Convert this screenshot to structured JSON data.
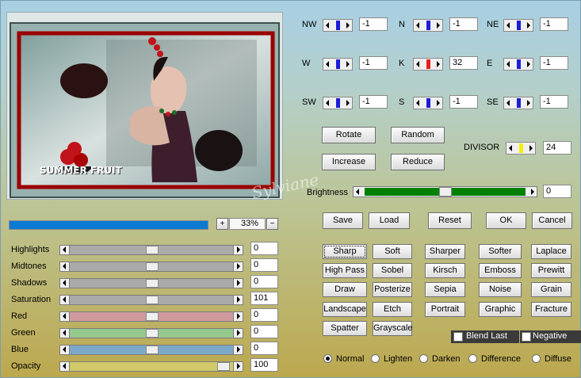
{
  "preview": {
    "text": "SUMMER FRUIT",
    "watermark": "Sylviane"
  },
  "zoom": {
    "plus": "+",
    "minus": "−",
    "value": "33%"
  },
  "direction": [
    {
      "key": "nw",
      "label": "NW",
      "value": "-1",
      "color": "#1c1cd8"
    },
    {
      "key": "n",
      "label": "N",
      "value": "-1",
      "color": "#1c1cd8"
    },
    {
      "key": "ne",
      "label": "NE",
      "value": "-1",
      "color": "#1c1cd8"
    },
    {
      "key": "w",
      "label": "W",
      "value": "-1",
      "color": "#1c1cd8"
    },
    {
      "key": "k",
      "label": "K",
      "value": "32",
      "color": "#e61f1f"
    },
    {
      "key": "e",
      "label": "E",
      "value": "-1",
      "color": "#1c1cd8"
    },
    {
      "key": "sw",
      "label": "SW",
      "value": "-1",
      "color": "#1c1cd8"
    },
    {
      "key": "s",
      "label": "S",
      "value": "-1",
      "color": "#1c1cd8"
    },
    {
      "key": "se",
      "label": "SE",
      "value": "-1",
      "color": "#1c1cd8"
    }
  ],
  "buttons": {
    "rotate": "Rotate",
    "random": "Random",
    "increase": "Increase",
    "reduce": "Reduce",
    "save": "Save",
    "load": "Load",
    "reset": "Reset",
    "ok": "OK",
    "cancel": "Cancel"
  },
  "divisor": {
    "label": "DIVISOR",
    "value": "24",
    "color": "#f4ee00"
  },
  "brightness": {
    "label": "Brightness",
    "value": "0",
    "fill": "#007f00"
  },
  "adjust": [
    {
      "label": "Highlights",
      "value": "0",
      "track": "#aaaaaa"
    },
    {
      "label": "Midtones",
      "value": "0",
      "track": "#aaaaaa"
    },
    {
      "label": "Shadows",
      "value": "0",
      "track": "#aaaaaa"
    },
    {
      "label": "Saturation",
      "value": "101",
      "track": "#aaaaaa"
    },
    {
      "label": "Red",
      "value": "0",
      "track": "#d09a9e"
    },
    {
      "label": "Green",
      "value": "0",
      "track": "#95c98d"
    },
    {
      "label": "Blue",
      "value": "0",
      "track": "#7ba8c7"
    },
    {
      "label": "Opacity",
      "value": "100",
      "track": "#d1c96a"
    }
  ],
  "presets": [
    [
      "Sharp",
      "Soft",
      "Sharper",
      "Softer",
      "Laplace"
    ],
    [
      "High Pass",
      "Sobel",
      "Kirsch",
      "Emboss",
      "Prewitt"
    ],
    [
      "Draw",
      "Posterize",
      "Sepia",
      "Noise",
      "Grain"
    ],
    [
      "Landscape",
      "Etch",
      "Portrait",
      "Graphic",
      "Fracture"
    ],
    [
      "Spatter",
      "Grayscale"
    ]
  ],
  "checks": {
    "blend": "Blend Last",
    "negative": "Negative"
  },
  "modes": {
    "selected": "Normal",
    "items": [
      "Normal",
      "Lighten",
      "Darken",
      "Difference",
      "Diffuse"
    ]
  }
}
